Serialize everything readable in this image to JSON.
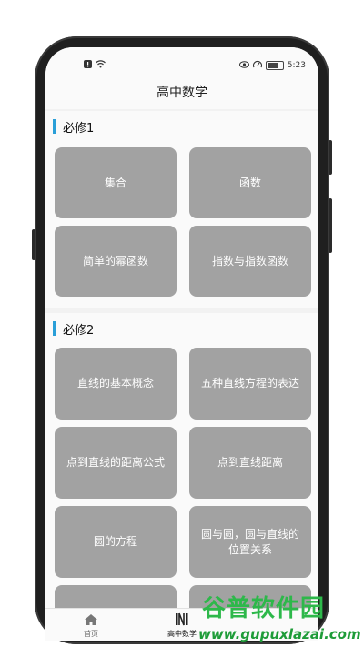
{
  "status_bar": {
    "time": "5:23"
  },
  "header": {
    "title": "高中数学"
  },
  "sections": [
    {
      "title": "必修1",
      "cards": [
        "集合",
        "函数",
        "简单的幂函数",
        "指数与指数函数"
      ]
    },
    {
      "title": "必修2",
      "cards": [
        "直线的基本概念",
        "五种直线方程的表达",
        "点到直线的距离公式",
        "点到直线距离",
        "圆的方程",
        "圆与圆，圆与直线的位置关系"
      ]
    }
  ],
  "tabs": [
    {
      "label": "首页",
      "icon": "home-icon"
    },
    {
      "label": "高中数学",
      "icon": "book-icon"
    }
  ],
  "watermark": {
    "title": "谷普软件园",
    "url": "www.gupuxlazai.com"
  },
  "colors": {
    "accent": "#2a9fd8",
    "card": "#a2a2a2",
    "watermark": "#2db84a"
  }
}
